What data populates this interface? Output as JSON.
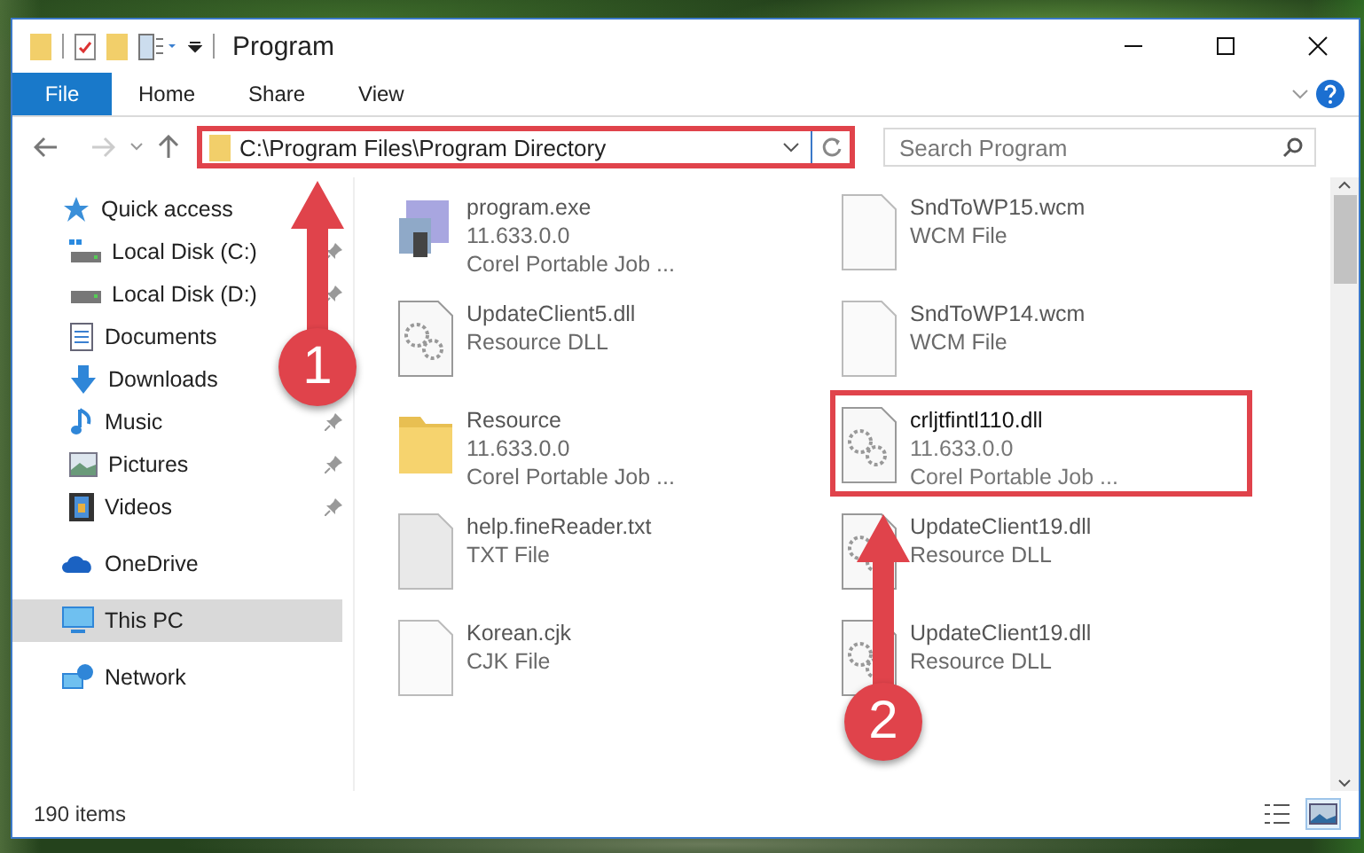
{
  "window": {
    "title": "Program"
  },
  "ribbon": {
    "tabs": [
      {
        "label": "File",
        "selected": true
      },
      {
        "label": "Home",
        "selected": false
      },
      {
        "label": "Share",
        "selected": false
      },
      {
        "label": "View",
        "selected": false
      }
    ]
  },
  "address_bar": {
    "path": "C:\\Program Files\\Program Directory",
    "outlined": true,
    "back_disabled": false,
    "forward_disabled": true
  },
  "search": {
    "placeholder": "Search Program"
  },
  "navigation": [
    {
      "label": "Quick access",
      "kind": "star",
      "selected": false,
      "children": [
        {
          "label": "Local Disk (C:)",
          "kind": "drive-windows",
          "pinned": true,
          "selected": false
        },
        {
          "label": "Local Disk (D:)",
          "kind": "drive",
          "pinned": true,
          "selected": false
        },
        {
          "label": "Documents",
          "kind": "document",
          "selected": false
        },
        {
          "label": "Downloads",
          "kind": "download",
          "selected": false
        },
        {
          "label": "Music",
          "kind": "music",
          "pinned": true,
          "selected": false
        },
        {
          "label": "Pictures",
          "kind": "pictures",
          "pinned": true,
          "selected": false
        },
        {
          "label": "Videos",
          "kind": "videos",
          "pinned": true,
          "selected": false
        }
      ]
    },
    {
      "label": "OneDrive",
      "kind": "cloud",
      "selected": false
    },
    {
      "label": "This PC",
      "kind": "computer",
      "selected": true
    },
    {
      "label": "Network",
      "kind": "network",
      "selected": false
    }
  ],
  "files": [
    {
      "name": "program.exe",
      "details": [
        "11.633.0.0",
        "Corel Portable Job ..."
      ],
      "kind": "exe",
      "dimmed": true,
      "outlined": false
    },
    {
      "name": "SndToWP15.wcm",
      "details": [
        "WCM File"
      ],
      "kind": "blank",
      "dimmed": true,
      "outlined": false
    },
    {
      "name": "UpdateClient5.dll",
      "details": [
        "Resource DLL"
      ],
      "kind": "dll",
      "dimmed": true,
      "outlined": false
    },
    {
      "name": "SndToWP14.wcm",
      "details": [
        "WCM File"
      ],
      "kind": "blank",
      "dimmed": true,
      "outlined": false
    },
    {
      "name": "Resource",
      "details": [
        "11.633.0.0",
        "Corel Portable Job ..."
      ],
      "kind": "folder",
      "dimmed": true,
      "outlined": false
    },
    {
      "name": "crljtfintl110.dll",
      "details": [
        "11.633.0.0",
        "Corel Portable Job ..."
      ],
      "kind": "dll",
      "dimmed": false,
      "outlined": true
    },
    {
      "name": "help.fineReader.txt",
      "details": [
        "TXT File"
      ],
      "kind": "text",
      "dimmed": true,
      "outlined": false
    },
    {
      "name": "UpdateClient19.dll",
      "details": [
        "Resource DLL"
      ],
      "kind": "dll",
      "dimmed": true,
      "outlined": false
    },
    {
      "name": "Korean.cjk",
      "details": [
        "CJK File"
      ],
      "kind": "blank",
      "dimmed": true,
      "outlined": false
    },
    {
      "name": "UpdateClient19.dll",
      "details": [
        "Resource DLL"
      ],
      "kind": "dll",
      "dimmed": true,
      "outlined": false
    }
  ],
  "status_bar": {
    "count": "190 items",
    "views": [
      {
        "kind": "details",
        "selected": false
      },
      {
        "kind": "large-icons",
        "selected": true
      }
    ]
  },
  "callouts": [
    {
      "number": "1",
      "kind": "address"
    },
    {
      "number": "2",
      "kind": "file"
    }
  ]
}
